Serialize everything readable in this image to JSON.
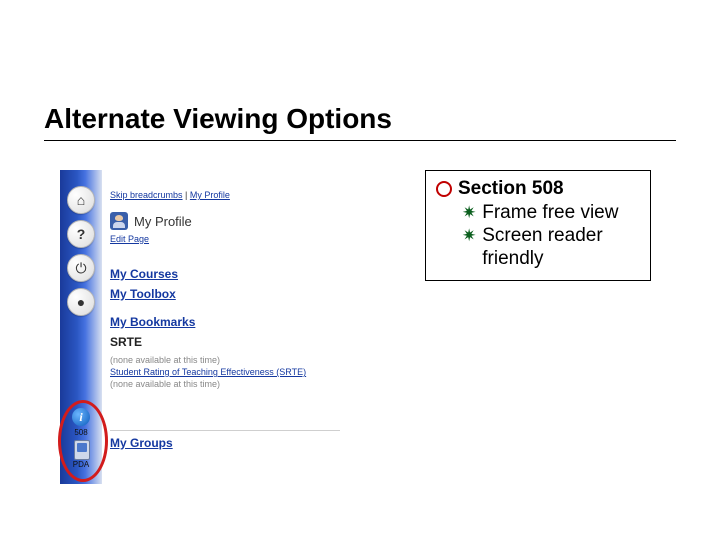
{
  "title": "Alternate Viewing Options",
  "sidebar": {
    "home_glyph": "⌂",
    "help_glyph": "?",
    "power_glyph": "⏻",
    "user_glyph": "●",
    "info_glyph": "i",
    "label_508": "508",
    "label_pda": "PDA"
  },
  "breadcrumb": {
    "skip": "Skip breadcrumbs",
    "sep": " | ",
    "profile": "My Profile"
  },
  "profile": {
    "title": "My Profile",
    "edit": "Edit Page"
  },
  "nav": {
    "courses": "My Courses",
    "toolbox": "My Toolbox",
    "bookmarks": "My Bookmarks",
    "srte": "SRTE",
    "groups": "My Groups"
  },
  "srte": {
    "none1": "(none available at this time)",
    "link": "Student Rating of Teaching Effectiveness (SRTE)",
    "none2": "(none available at this time)"
  },
  "info": {
    "heading": "Section 508",
    "item1": "Frame free view",
    "item2": "Screen reader friendly"
  }
}
